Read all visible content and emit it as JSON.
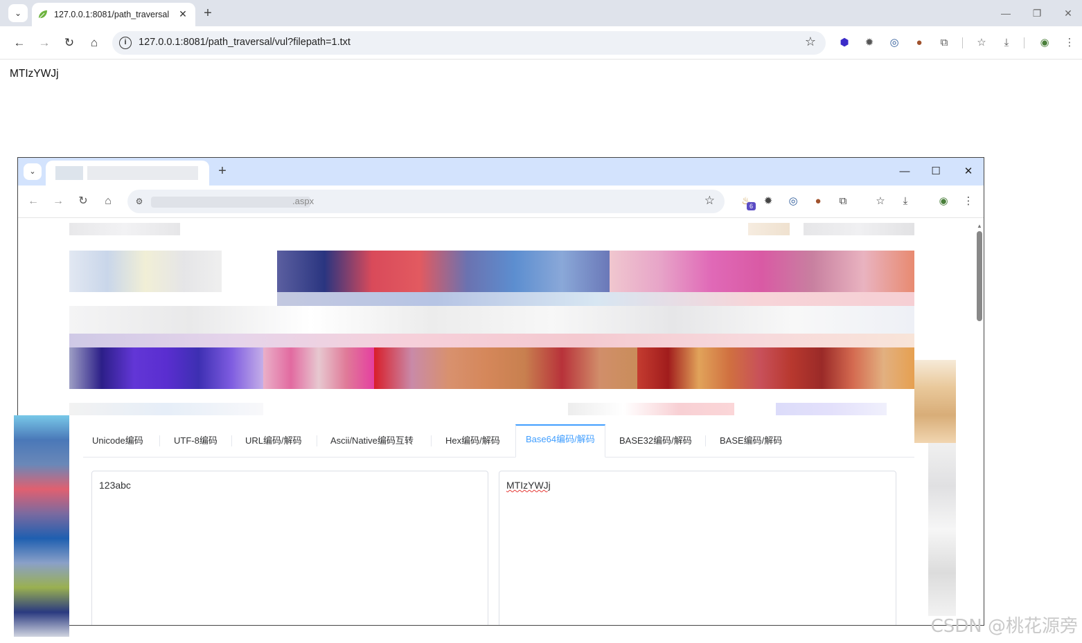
{
  "outer_browser": {
    "tab_title": "127.0.0.1:8081/path_traversal",
    "url": "127.0.0.1:8081/path_traversal/vul?filepath=1.txt",
    "page_text": "MTIzYWJj"
  },
  "inner_browser": {
    "url_suffix": ".aspx",
    "extension_badge": "6",
    "tabs": [
      "Unicode编码",
      "UTF-8编码",
      "URL编码/解码",
      "Ascii/Native编码互转",
      "Hex编码/解码",
      "Base64编码/解码",
      "BASE32编码/解码",
      "BASE编码/解码"
    ],
    "active_tab": "Base64编码/解码",
    "input_text": "123abc",
    "output_text": "MTIzYWJj"
  },
  "watermark": "CSDN @桃花源旁",
  "colors": {
    "active_tab": "#409eff",
    "tabstrip_outer": "#dfe3eb",
    "tabstrip_inner": "#d3e3fd"
  }
}
